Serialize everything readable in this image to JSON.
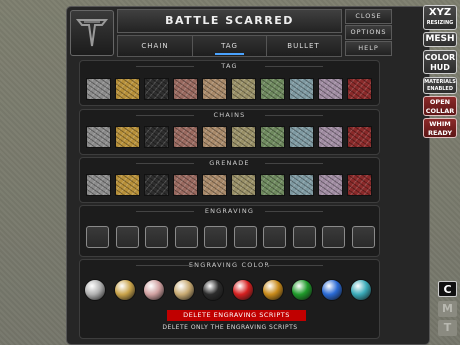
{
  "window": {
    "title": "BATTLE SCARRED"
  },
  "tabs": [
    {
      "label": "CHAIN",
      "active": false
    },
    {
      "label": "TAG",
      "active": true
    },
    {
      "label": "BULLET",
      "active": false
    }
  ],
  "right_buttons": {
    "close": "CLOSE",
    "options": "OPTIONS",
    "help": "HELP"
  },
  "sections": {
    "tag": "TAG",
    "chains": "CHAINS",
    "grenade": "GRENADE",
    "engraving": "ENGRAVING",
    "engraving_color": "ENGRAVING COLOR"
  },
  "texture_colors": [
    "#8c8c8c",
    "#b8913a",
    "#2e2e2e",
    "#9a6a60",
    "#a98a6a",
    "#9a9168",
    "#6f8a5f",
    "#7f9aa2",
    "#a08ca2",
    "#8a2a2a"
  ],
  "engraving_color_balls": [
    {
      "name": "silver-ball",
      "color": "#b0b0b0"
    },
    {
      "name": "gold-ball",
      "color": "#c9a34a"
    },
    {
      "name": "rose-ball",
      "color": "#d0a0a0"
    },
    {
      "name": "tan-ball",
      "color": "#c8aa72"
    },
    {
      "name": "black-ball",
      "color": "#2c2c2c"
    },
    {
      "name": "red-ball",
      "color": "#d52020"
    },
    {
      "name": "amber-ball",
      "color": "#c88a1a"
    },
    {
      "name": "green-ball",
      "color": "#1f9a2a"
    },
    {
      "name": "blue-ball",
      "color": "#2a6ad5"
    },
    {
      "name": "teal-ball",
      "color": "#3aaab8"
    }
  ],
  "engraving_slot_count": 10,
  "actions": {
    "delete_scripts": "DELETE ENGRAVING SCRIPTS",
    "delete_note": "DELETE ONLY THE ENGRAVING SCRIPTS"
  },
  "side_buttons": {
    "xyz": [
      "XYZ",
      "RESIZING"
    ],
    "mesh": "MESH",
    "color": [
      "COLOR",
      "HUD"
    ],
    "materials": [
      "MATERIALS",
      "ENABLED"
    ],
    "open": [
      "OPEN",
      "COLLAR"
    ],
    "whim": [
      "WHIM",
      "READY"
    ]
  },
  "cmt_buttons": [
    "C",
    "M",
    "T"
  ],
  "accent_color": "#4aa3ff"
}
